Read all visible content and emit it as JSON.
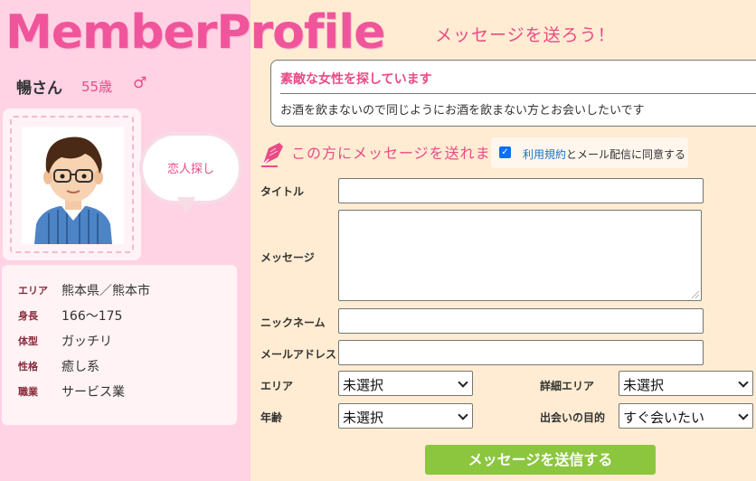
{
  "header": {
    "logo_text": "MemberProfile",
    "tagline": "メッセージを送ろう！"
  },
  "member": {
    "name": "暢さん",
    "age": "55歳",
    "gender_symbol": "♂",
    "bubble_text": "恋人探し",
    "info": [
      {
        "label": "エリア",
        "value": "熊本県／熊本市"
      },
      {
        "label": "身長",
        "value": "166〜175"
      },
      {
        "label": "体型",
        "value": "ガッチリ"
      },
      {
        "label": "性格",
        "value": "癒し系"
      },
      {
        "label": "職業",
        "value": "サービス業"
      }
    ]
  },
  "intro": {
    "title": "素敵な女性を探しています",
    "text": "お酒を飲まないので同じようにお酒を飲まない方とお会いしたいです"
  },
  "form": {
    "heading": "この方にメッセージを送れます",
    "agree": {
      "checked": true,
      "link_text": "利用規約",
      "rest_text": "とメール配信に同意する"
    },
    "labels": {
      "title": "タイトル",
      "message": "メッセージ",
      "nickname": "ニックネーム",
      "email": "メールアドレス",
      "area": "エリア",
      "detail_area": "詳細エリア",
      "age": "年齢",
      "purpose": "出会いの目的"
    },
    "values": {
      "title": "",
      "message": "",
      "nickname": "",
      "email": ""
    },
    "selects": {
      "area": "未選択",
      "detail_area": "未選択",
      "age": "未選択",
      "purpose": "すぐ会いたい"
    },
    "submit_label": "メッセージを送信する"
  },
  "icons": {
    "pen": "pen-icon",
    "gender": "male-symbol-icon",
    "avatar": "avatar-illustration"
  },
  "colors": {
    "accent_pink": "#e94b86",
    "left_bg": "#ffd2e4",
    "right_bg": "#ffecd2",
    "submit_green": "#8cc63f",
    "checkbox_blue": "#0b6ff5"
  }
}
